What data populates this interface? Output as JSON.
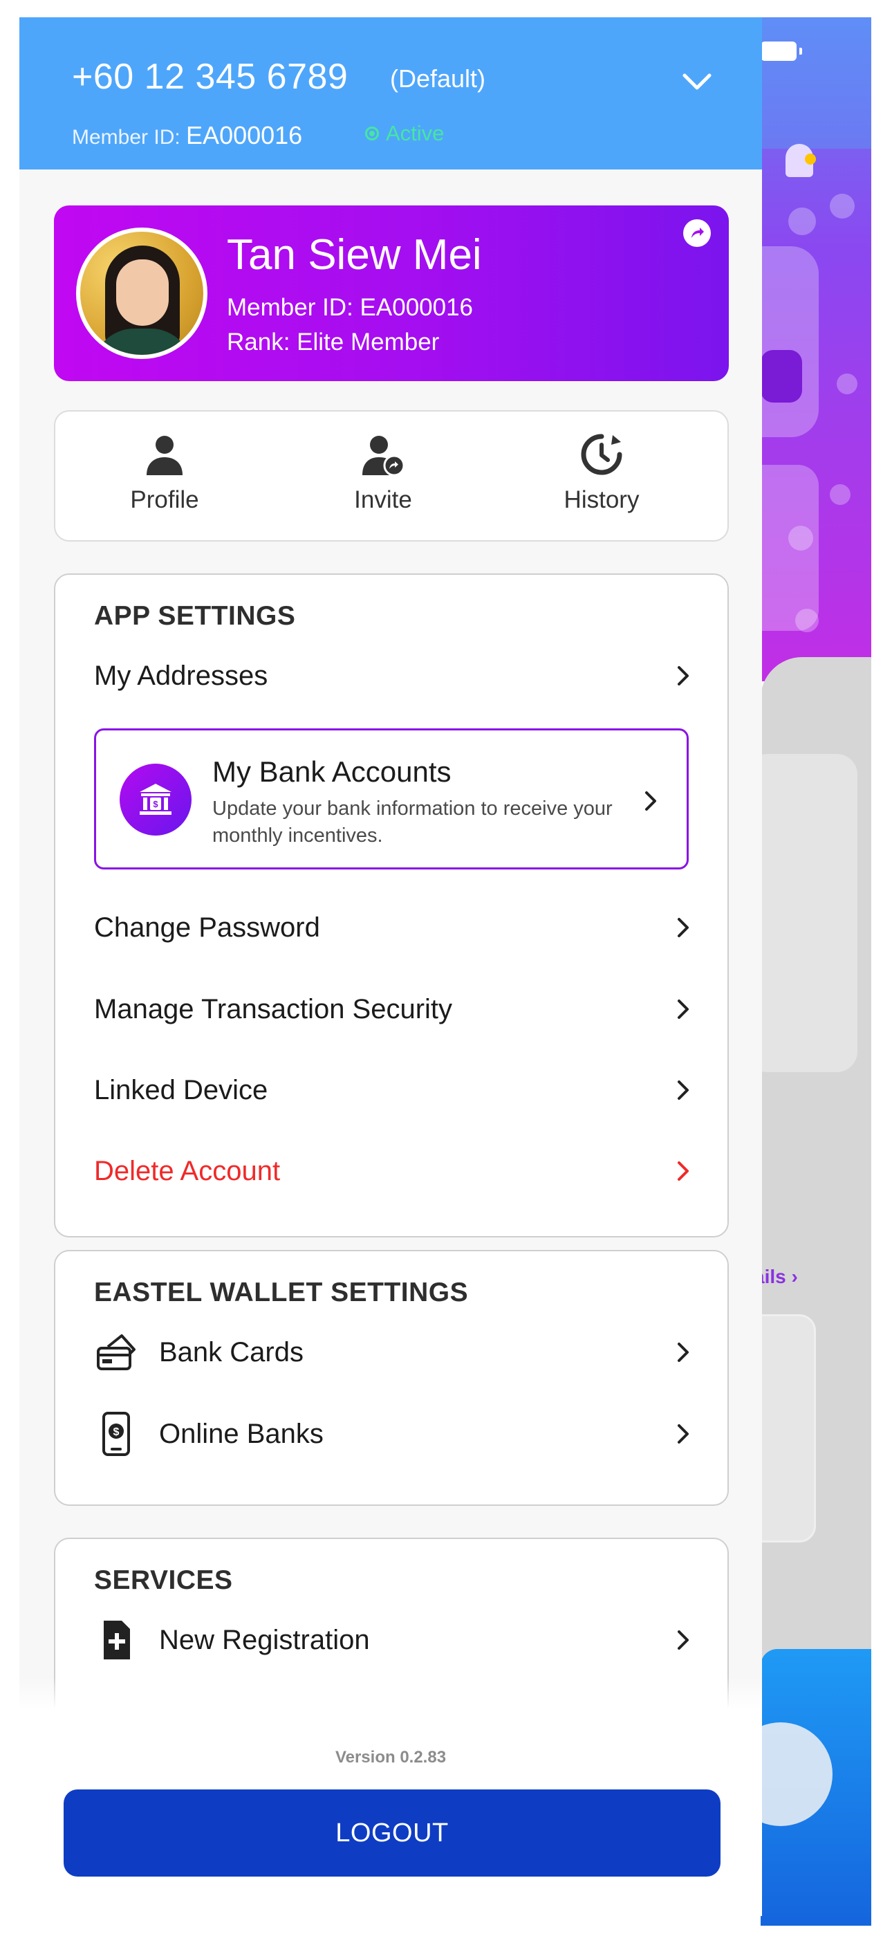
{
  "header": {
    "phone": "+60 12 345 6789",
    "default_tag": "(Default)",
    "member_label": "Member ID:",
    "member_id": "EA000016",
    "status": "Active"
  },
  "profile": {
    "name": "Tan Siew Mei",
    "member_id_line": "Member ID: EA000016",
    "rank_line": "Rank: Elite Member"
  },
  "quick_actions": [
    {
      "label": "Profile",
      "icon": "person-icon"
    },
    {
      "label": "Invite",
      "icon": "invite-user-icon"
    },
    {
      "label": "History",
      "icon": "history-clock-icon"
    }
  ],
  "app_settings": {
    "title": "APP SETTINGS",
    "addresses": "My Addresses",
    "bank_accounts": {
      "title": "My Bank Accounts",
      "description": "Update your bank information to receive your monthly incentives."
    },
    "change_password": "Change Password",
    "transaction_security": "Manage Transaction Security",
    "linked_device": "Linked Device",
    "delete_account": "Delete Account"
  },
  "wallet_settings": {
    "title": "EASTEL WALLET SETTINGS",
    "bank_cards": "Bank Cards",
    "online_banks": "Online Banks"
  },
  "services": {
    "title": "SERVICES",
    "new_registration": "New Registration"
  },
  "footer": {
    "version": "Version 0.2.83",
    "logout": "LOGOUT"
  },
  "background": {
    "details_link": "ails"
  },
  "colors": {
    "header_blue": "#4ea6fb",
    "profile_gradient_start": "#c108f2",
    "profile_gradient_end": "#7b14ee",
    "danger": "#f02929",
    "logout_blue": "#0e3dc4",
    "active_green": "#46e6a0",
    "highlight_purple": "#8a14e6"
  }
}
